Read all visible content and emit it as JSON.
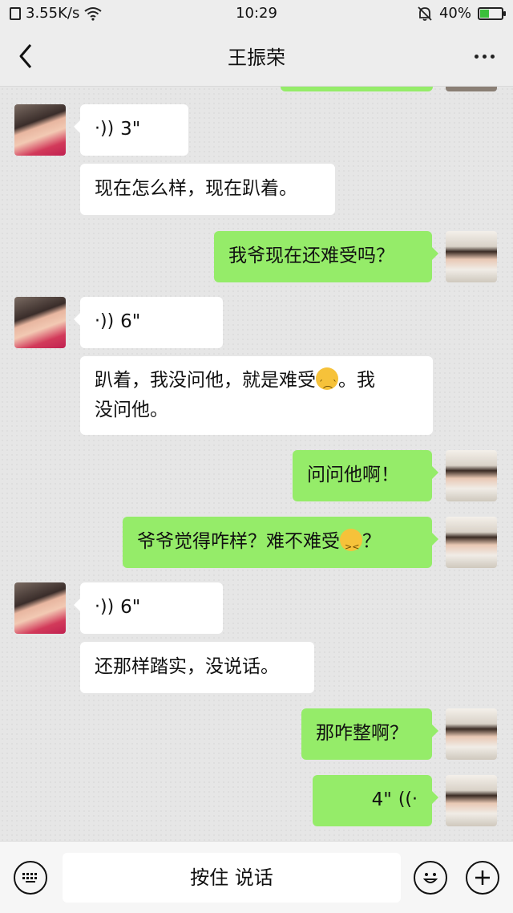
{
  "status_bar": {
    "network_speed": "3.55K/s",
    "time": "10:29",
    "battery_text": "40%",
    "battery_level": 0.4,
    "icons": [
      "data-icon",
      "wifi-icon",
      "mute-bell-icon",
      "battery-icon"
    ]
  },
  "header": {
    "title": "王振荣",
    "back_icon": "chevron-left-icon",
    "more_icon": "more-dots-icon"
  },
  "messages": [
    {
      "side": "left",
      "type": "voice",
      "duration": "3\""
    },
    {
      "side": "left",
      "type": "text",
      "text": "现在怎么样，现在趴着。"
    },
    {
      "side": "right",
      "type": "text",
      "text": "我爷现在还难受吗？"
    },
    {
      "side": "left",
      "type": "voice",
      "duration": "6\""
    },
    {
      "side": "left",
      "type": "text",
      "text_line1_before": "趴着，我没问他，就是难受",
      "emoji1": "crying-face-emoji",
      "text_line1_after": "。我",
      "text_line2": "没问他。"
    },
    {
      "side": "right",
      "type": "text",
      "text": "问问他啊！"
    },
    {
      "side": "right",
      "type": "text",
      "text_before": "爷爷觉得咋样？难不难受",
      "emoji": "confounded-face-emoji",
      "text_after": "？"
    },
    {
      "side": "left",
      "type": "voice",
      "duration": "6\""
    },
    {
      "side": "left",
      "type": "text",
      "text": "还那样踏实，没说话。"
    },
    {
      "side": "right",
      "type": "text",
      "text": "那咋整啊？"
    },
    {
      "side": "right",
      "type": "voice",
      "duration": "4\""
    }
  ],
  "input_bar": {
    "keyboard_icon": "keyboard-icon",
    "hold_to_talk_label": "按住 说话",
    "emoji_icon": "emoji-icon",
    "plus_icon": "plus-icon"
  },
  "colors": {
    "outgoing_bubble": "#95ec69",
    "incoming_bubble": "#ffffff",
    "background": "#ededed"
  }
}
